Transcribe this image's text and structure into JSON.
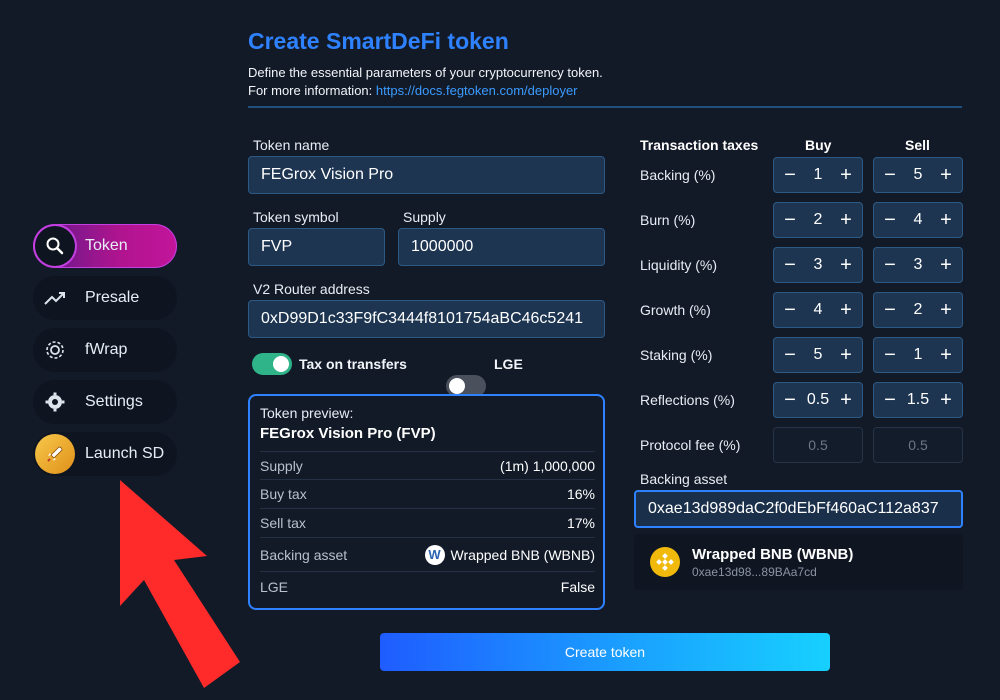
{
  "header": {
    "title": "Create SmartDeFi token",
    "subtitle": "Define the essential parameters of your cryptocurrency token.",
    "info_prefix": "For more information:",
    "info_link": "https://docs.fegtoken.com/deployer"
  },
  "sidebar": {
    "items": [
      {
        "label": "Token",
        "icon": "search-icon"
      },
      {
        "label": "Presale",
        "icon": "trend-icon"
      },
      {
        "label": "fWrap",
        "icon": "gear-box-icon"
      },
      {
        "label": "Settings",
        "icon": "gear-icon"
      },
      {
        "label": "Launch SD",
        "icon": "rocket-icon"
      }
    ]
  },
  "form": {
    "token_name_label": "Token name",
    "token_name_value": "FEGrox Vision Pro",
    "token_symbol_label": "Token symbol",
    "token_symbol_value": "FVP",
    "supply_label": "Supply",
    "supply_value": "1000000",
    "router_label": "V2 Router address",
    "router_value": "0xD99D1c33F9fC3444f8101754aBC46c5241",
    "tax_transfers_label": "Tax on transfers",
    "lge_label": "LGE"
  },
  "preview": {
    "heading": "Token preview:",
    "name": "FEGrox Vision Pro (FVP)",
    "rows": [
      {
        "key": "Supply",
        "value": "(1m) 1,000,000"
      },
      {
        "key": "Buy tax",
        "value": "16%"
      },
      {
        "key": "Sell tax",
        "value": "17%"
      },
      {
        "key": "Backing asset",
        "value": "Wrapped BNB (WBNB)"
      },
      {
        "key": "LGE",
        "value": "False"
      }
    ],
    "backing_badge": "W"
  },
  "taxes": {
    "header": "Transaction taxes",
    "buy_header": "Buy",
    "sell_header": "Sell",
    "rows": [
      {
        "label": "Backing (%)",
        "buy": "1",
        "sell": "5"
      },
      {
        "label": "Burn (%)",
        "buy": "2",
        "sell": "4"
      },
      {
        "label": "Liquidity (%)",
        "buy": "3",
        "sell": "3"
      },
      {
        "label": "Growth (%)",
        "buy": "4",
        "sell": "2"
      },
      {
        "label": "Staking (%)",
        "buy": "5",
        "sell": "1"
      },
      {
        "label": "Reflections (%)",
        "buy": "0.5",
        "sell": "1.5"
      }
    ],
    "protocol_label": "Protocol fee (%)",
    "protocol_buy": "0.5",
    "protocol_sell": "0.5",
    "minus": "−",
    "plus": "+"
  },
  "backing": {
    "label": "Backing asset",
    "value": "0xae13d989daC2f0dEbFf460aC112a837",
    "option_name": "Wrapped BNB (WBNB)",
    "option_address": "0xae13d98...89BAa7cd"
  },
  "actions": {
    "create_label": "Create token"
  },
  "colors": {
    "accent": "#2f82ff",
    "background": "#131a27",
    "input_bg": "#1d3551",
    "toggle_on": "#2fb48a"
  }
}
